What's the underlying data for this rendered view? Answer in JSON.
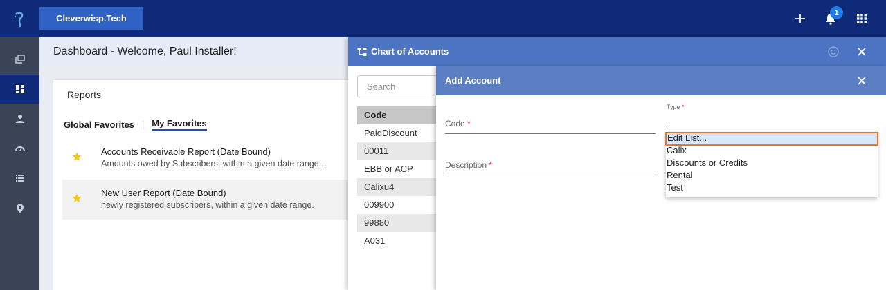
{
  "topbar": {
    "org_name": "Cleverwisp.Tech",
    "notification_count": "1",
    "colors": {
      "bar": "#0e2a78",
      "org_button": "#2f62c4"
    }
  },
  "rail": {
    "items": [
      "reports-icon",
      "dashboard-icon",
      "person-icon",
      "speedometer-icon",
      "list-icon",
      "location-icon"
    ],
    "active": "dashboard-icon"
  },
  "dashboard": {
    "title": "Dashboard - Welcome, Paul Installer!",
    "reports": {
      "title": "Reports",
      "tabs": [
        "Global Favorites",
        "My Favorites"
      ],
      "active_tab": "My Favorites",
      "items": [
        {
          "title": "Accounts Receivable Report (Date Bound)",
          "description": "Amounts owed by Subscribers, within a given date range..."
        },
        {
          "title": "New User Report (Date Bound)",
          "description": "newly registered subscribers, within a given date range."
        }
      ]
    }
  },
  "chart_of_accounts": {
    "title": "Chart of Accounts",
    "search_placeholder": "Search",
    "column_header": "Code",
    "codes": [
      "PaidDiscount",
      "00011",
      "EBB or ACP",
      "Calixu4",
      "009900",
      "99880",
      "A031"
    ]
  },
  "add_account": {
    "title": "Add Account",
    "code_label": "Code",
    "description_label": "Description",
    "required_mark": "*",
    "type_label": "Type",
    "type_options": [
      "Edit List...",
      "Calix",
      "Discounts or Credits",
      "Rental",
      "Test"
    ],
    "highlighted_option": "Edit List...",
    "colors": {
      "header": "#5c7fc4",
      "highlight_border": "#e8762d",
      "required": "#d32f2f"
    }
  }
}
